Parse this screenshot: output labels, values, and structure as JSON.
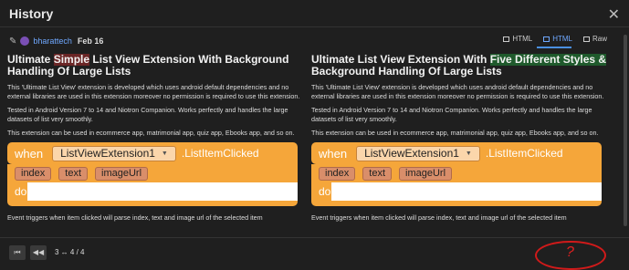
{
  "modal": {
    "title": "History"
  },
  "meta": {
    "author": "bharattech",
    "date": "Feb 16"
  },
  "view_tabs": [
    {
      "label": "HTML",
      "active": false
    },
    {
      "label": "HTML",
      "active": true
    },
    {
      "label": "Raw",
      "active": false
    }
  ],
  "left": {
    "title_pre": "Ultimate ",
    "title_del": "Simple",
    "title_post": " List View Extension With Background Handling Of Large Lists",
    "p1": "This 'Ultimate List View' extension is developed which uses android default dependencies and no external libraries are used in this extension moreover no permission is required to use this extension.",
    "p2": "Tested in Android Version 7 to 14 and Niotron Companion. Works perfectly and handles the large datasets of list very smoothly.",
    "p3": "This extension can be used in ecommerce app, matrimonial app, quiz app, Ebooks app, and so on.",
    "p4": "Event triggers when item clicked will parse index, text and image url of the selected item"
  },
  "right": {
    "title_pre": "Ultimate List View Extension With ",
    "title_ins": "Five Different Styles &",
    "title_post": " Background Handling Of Large Lists",
    "p1": "This 'Ultimate List View' extension is developed which uses android default dependencies and no external libraries are used in this extension moreover no permission is required to use this extension.",
    "p2": "Tested in Android Version 7 to 14 and Niotron Companion. Works perfectly and handles the large datasets of list very smoothly.",
    "p3": "This extension can be used in ecommerce app, matrimonial app, quiz app, Ebooks app, and so on.",
    "p4": "Event triggers when item clicked will parse index, text and image url of the selected item"
  },
  "block": {
    "when": "when",
    "component": "ListViewExtension1",
    "event": ".ListItemClicked",
    "params": [
      "index",
      "text",
      "imageUrl"
    ],
    "do": "do"
  },
  "pager": {
    "text": "3 ↔ 4 / 4"
  },
  "annotation": {
    "text": "?"
  },
  "colors": {
    "accent": "#4a8fe0",
    "block": "#f5a63a",
    "deleted": "#6b2626",
    "inserted": "#1f5a2c",
    "scribble": "#d01a1a"
  }
}
